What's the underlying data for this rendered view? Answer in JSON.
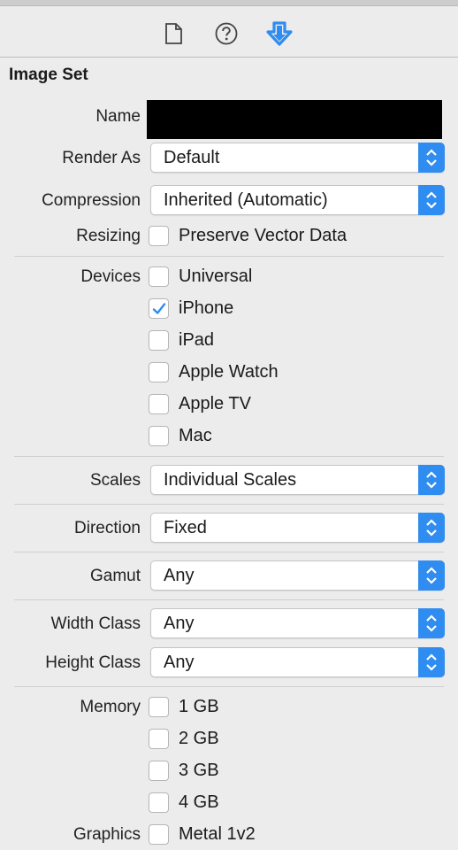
{
  "toolbar": {
    "icons": [
      "file-inspector-icon",
      "quick-help-icon",
      "attributes-inspector-icon"
    ],
    "active_color": "#2f8cf0"
  },
  "section_title": "Image Set",
  "labels": {
    "name": "Name",
    "render_as": "Render As",
    "compression": "Compression",
    "resizing": "Resizing",
    "devices": "Devices",
    "scales": "Scales",
    "direction": "Direction",
    "gamut": "Gamut",
    "width_class": "Width Class",
    "height_class": "Height Class",
    "memory": "Memory",
    "graphics": "Graphics"
  },
  "popups": {
    "render_as": "Default",
    "compression": "Inherited (Automatic)",
    "scales": "Individual Scales",
    "direction": "Fixed",
    "gamut": "Any",
    "width_class": "Any",
    "height_class": "Any"
  },
  "resizing": {
    "label": "Preserve Vector Data",
    "checked": false
  },
  "devices": [
    {
      "label": "Universal",
      "checked": false
    },
    {
      "label": "iPhone",
      "checked": true
    },
    {
      "label": "iPad",
      "checked": false
    },
    {
      "label": "Apple Watch",
      "checked": false
    },
    {
      "label": "Apple TV",
      "checked": false
    },
    {
      "label": "Mac",
      "checked": false
    }
  ],
  "memory": [
    {
      "label": "1 GB",
      "checked": false
    },
    {
      "label": "2 GB",
      "checked": false
    },
    {
      "label": "3 GB",
      "checked": false
    },
    {
      "label": "4 GB",
      "checked": false
    }
  ],
  "graphics": [
    {
      "label": "Metal 1v2",
      "checked": false
    }
  ],
  "accent_color": "#2f8cf0"
}
